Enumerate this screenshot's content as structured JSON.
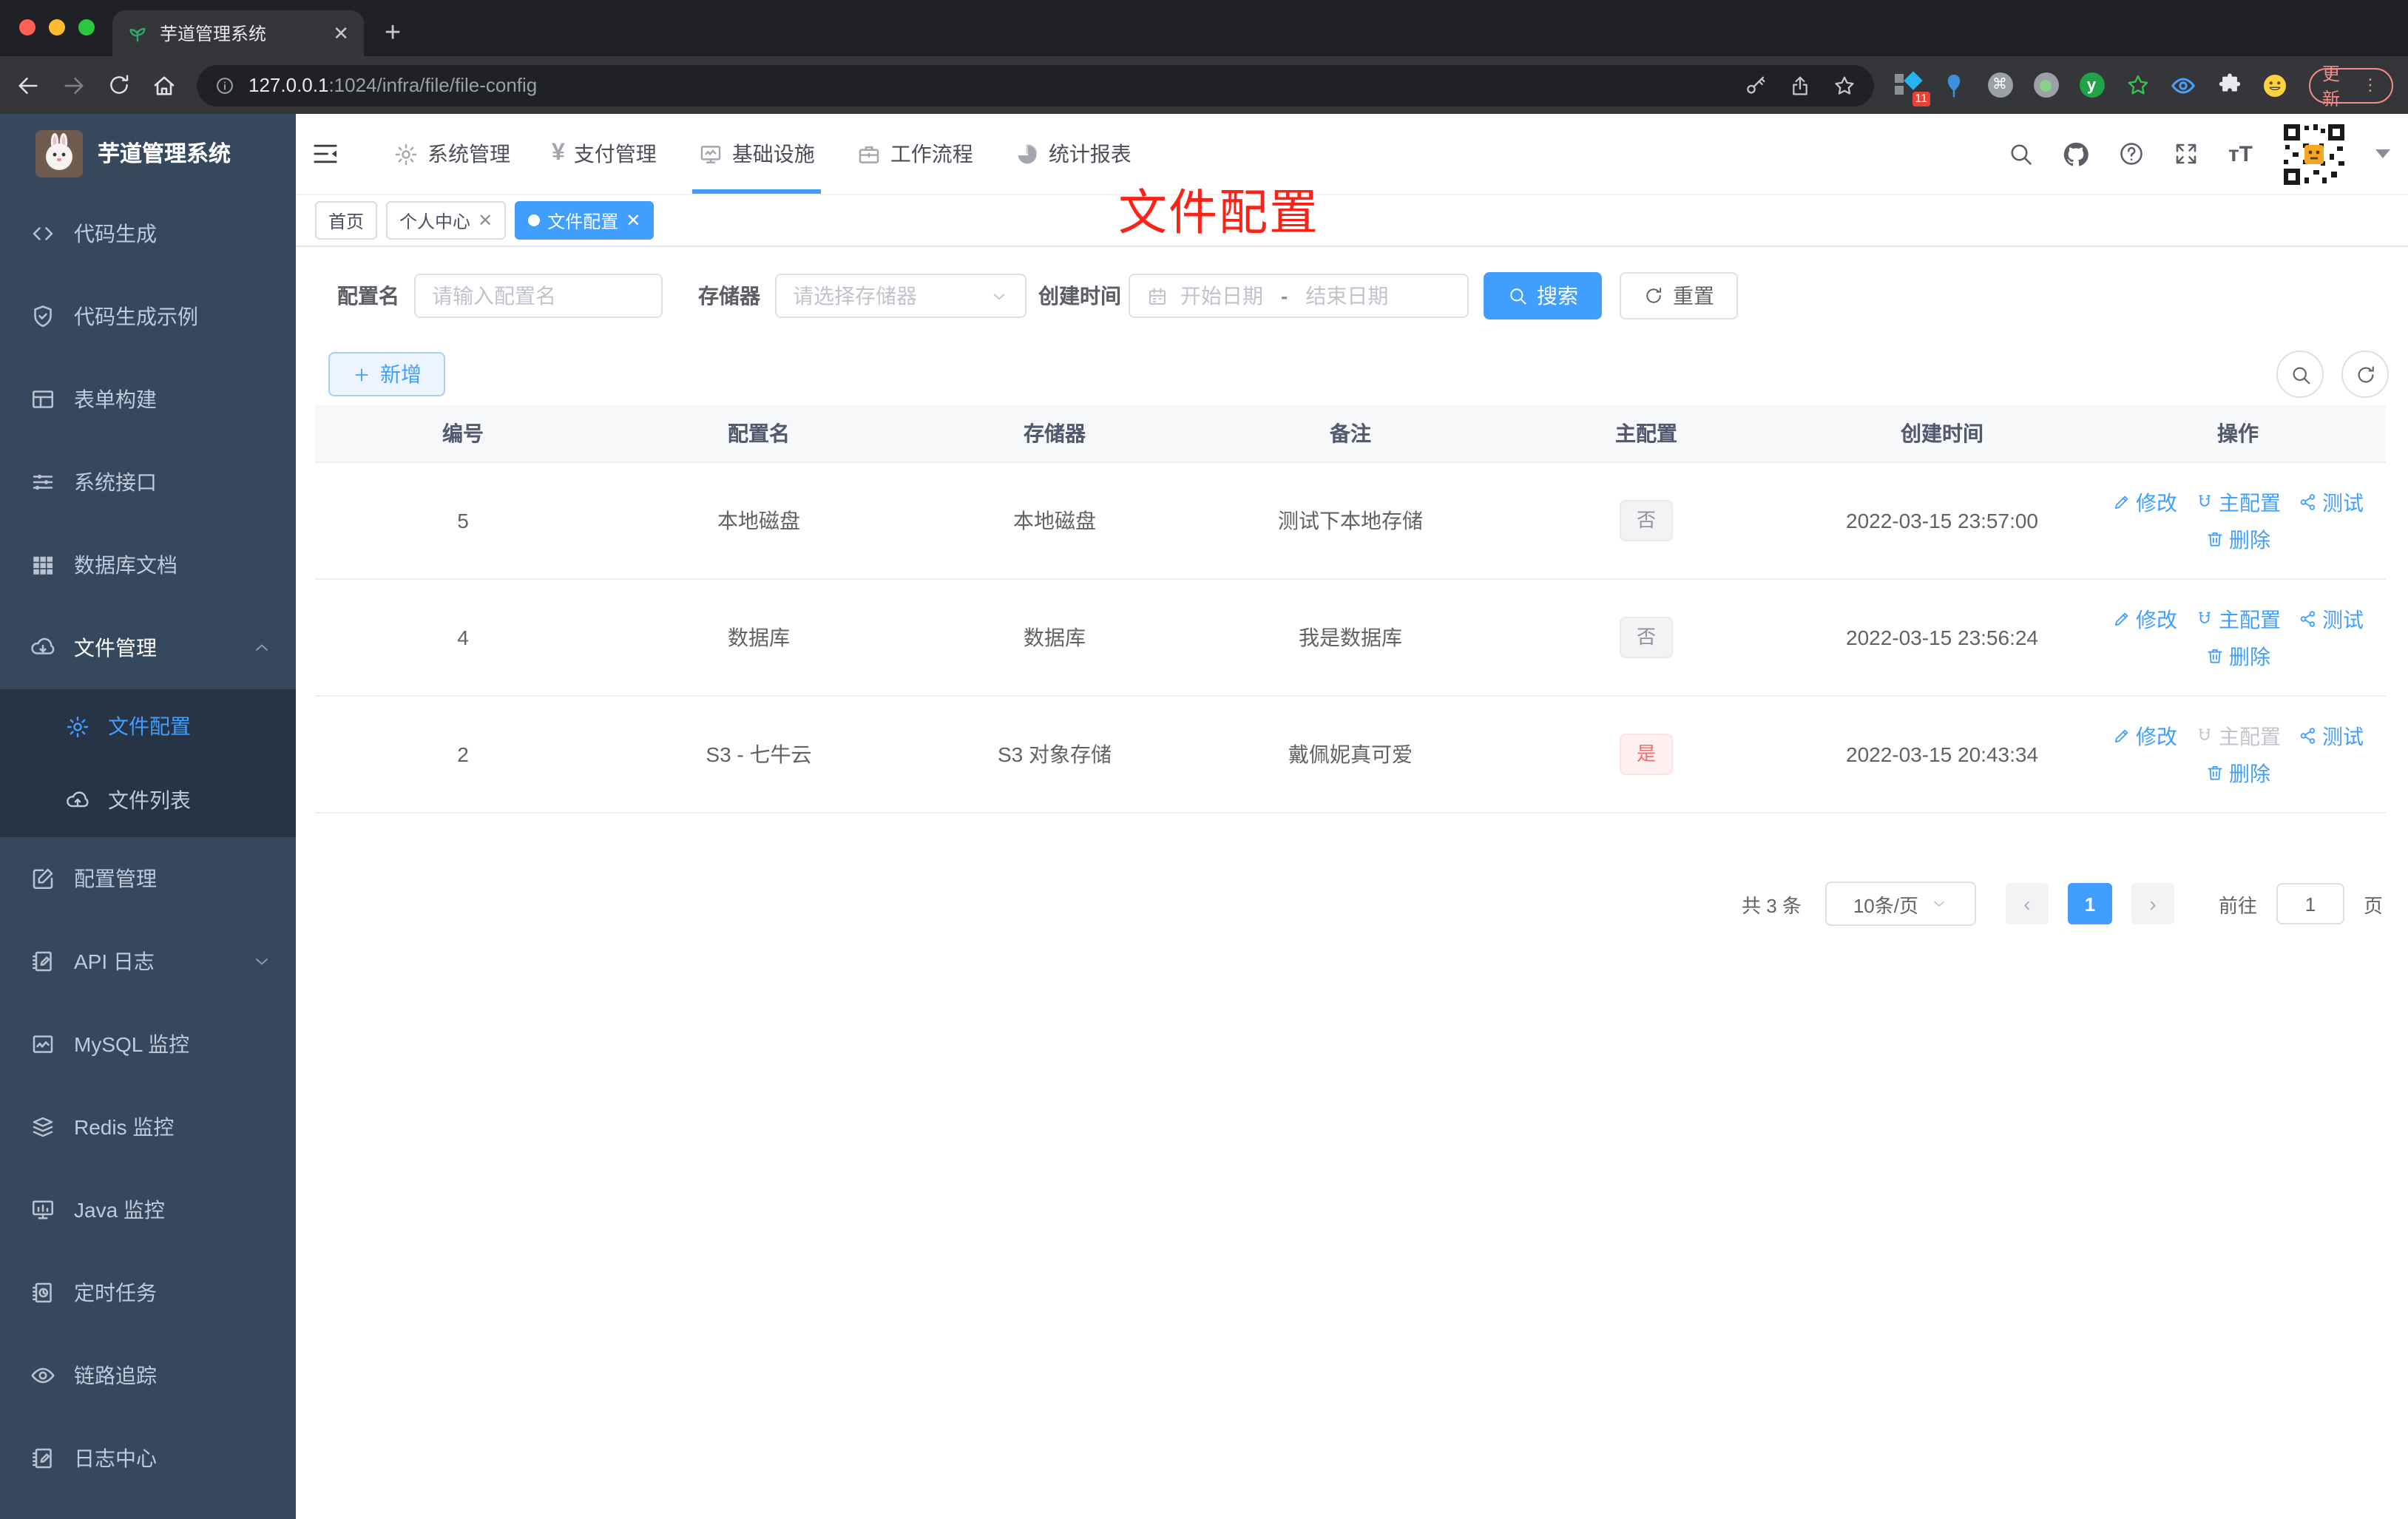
{
  "browser": {
    "tab_title": "芋道管理系统",
    "url_host": "127.0.0.1",
    "url_rest": ":1024/infra/file/file-config",
    "update_label": "更新",
    "ext_badge": "11"
  },
  "sidebar": {
    "title": "芋道管理系统",
    "items": [
      "代码生成",
      "代码生成示例",
      "表单构建",
      "系统接口",
      "数据库文档",
      "文件管理",
      "文件配置",
      "文件列表",
      "配置管理",
      "API 日志",
      "MySQL 监控",
      "Redis 监控",
      "Java 监控",
      "定时任务",
      "链路追踪",
      "日志中心"
    ]
  },
  "topnav": [
    "系统管理",
    "支付管理",
    "基础设施",
    "工作流程",
    "统计报表"
  ],
  "tags": [
    "首页",
    "个人中心",
    "文件配置"
  ],
  "annotation": "文件配置",
  "filters": {
    "name_label": "配置名",
    "name_placeholder": "请输入配置名",
    "storage_label": "存储器",
    "storage_placeholder": "请选择存储器",
    "time_label": "创建时间",
    "start_placeholder": "开始日期",
    "separator": "-",
    "end_placeholder": "结束日期",
    "search": "搜索",
    "reset": "重置",
    "add": "新增"
  },
  "table": {
    "headers": [
      "编号",
      "配置名",
      "存储器",
      "备注",
      "主配置",
      "创建时间",
      "操作"
    ],
    "actions": {
      "edit": "修改",
      "master": "主配置",
      "test": "测试",
      "del": "删除"
    },
    "rows": [
      {
        "id": "5",
        "name": "本地磁盘",
        "storage": "本地磁盘",
        "remark": "测试下本地存储",
        "master": "否",
        "time": "2022-03-15 23:57:00"
      },
      {
        "id": "4",
        "name": "数据库",
        "storage": "数据库",
        "remark": "我是数据库",
        "master": "否",
        "time": "2022-03-15 23:56:24"
      },
      {
        "id": "2",
        "name": "S3 - 七牛云",
        "storage": "S3 对象存储",
        "remark": "戴佩妮真可爱",
        "master": "是",
        "time": "2022-03-15 20:43:34"
      }
    ]
  },
  "pagination": {
    "total": "共 3 条",
    "size": "10条/页",
    "page": "1",
    "goto": "前往",
    "unit": "页",
    "input": "1"
  },
  "colors": {
    "accent": "#409eff",
    "danger": "#f56c6c",
    "sidebar": "#36485e"
  }
}
